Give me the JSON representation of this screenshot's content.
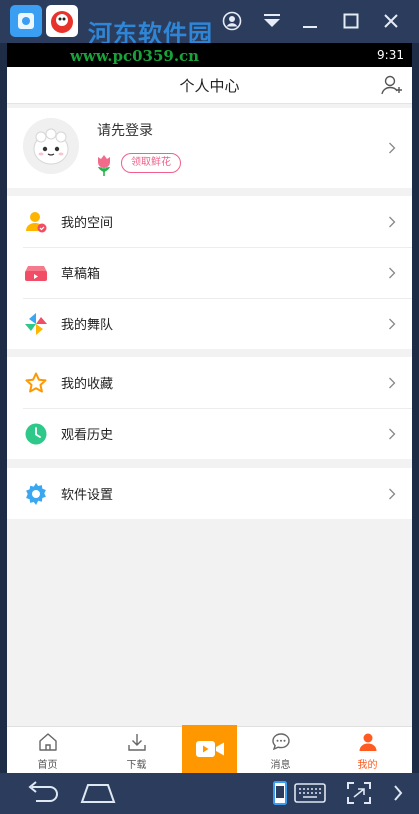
{
  "emulator": {
    "watermark_text": "河东软件园",
    "watermark_url": "www.pc0359.cn",
    "accent": "#2b3c5c"
  },
  "status_bar": {
    "time": "9:31"
  },
  "header": {
    "title": "个人中心",
    "icon": "add-friend-icon"
  },
  "profile": {
    "login_prompt": "请先登录",
    "flower_button": "领取鲜花",
    "accent": "#f0608a"
  },
  "menu": {
    "group1": [
      {
        "label": "我的空间",
        "icon": "user-space-icon",
        "color": "#ffb400"
      },
      {
        "label": "草稿箱",
        "icon": "drafts-icon",
        "color": "#f14d66"
      },
      {
        "label": "我的舞队",
        "icon": "pinwheel-icon",
        "color": "#3aa7f0"
      }
    ],
    "group2": [
      {
        "label": "我的收藏",
        "icon": "star-icon",
        "color": "#ff9800"
      },
      {
        "label": "观看历史",
        "icon": "clock-icon",
        "color": "#2ec98a"
      }
    ],
    "group3": [
      {
        "label": "软件设置",
        "icon": "gear-icon",
        "color": "#3aa7f0"
      }
    ]
  },
  "tabbar": {
    "tabs": [
      {
        "label": "首页",
        "icon": "home-icon"
      },
      {
        "label": "下载",
        "icon": "download-icon"
      },
      {
        "label": "",
        "icon": "video-camera-icon"
      },
      {
        "label": "消息",
        "icon": "message-icon"
      },
      {
        "label": "我的",
        "icon": "profile-icon"
      }
    ],
    "active_color": "#ff5a1f",
    "center_color": "#ff9800"
  }
}
